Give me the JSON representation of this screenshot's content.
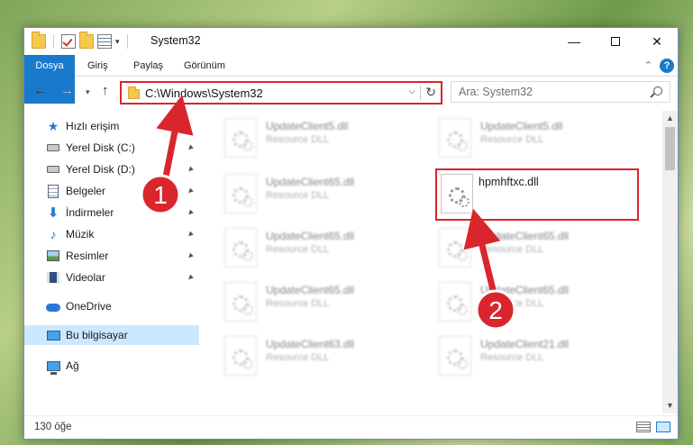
{
  "window": {
    "title": "System32",
    "minimize": "—",
    "maximize": "",
    "close": "✕"
  },
  "ribbon": {
    "tabs": [
      "Dosya",
      "Giriş",
      "Paylaş",
      "Görünüm"
    ],
    "collapse": "⌃",
    "help": "?"
  },
  "nav": {
    "back": "←",
    "forward": "→",
    "recent": "▾",
    "up": "↑",
    "address": "C:\\Windows\\System32",
    "address_dropdown": "⌵",
    "refresh": "↻",
    "search_placeholder": "Ara: System32"
  },
  "sidebar": {
    "items": [
      {
        "label": "Hızlı erişim",
        "icon": "star-icon",
        "pinned": false
      },
      {
        "label": "Yerel Disk (C:)",
        "icon": "disk-icon",
        "pinned": true
      },
      {
        "label": "Yerel Disk (D:)",
        "icon": "disk-icon",
        "pinned": true
      },
      {
        "label": "Belgeler",
        "icon": "documents-icon",
        "pinned": true
      },
      {
        "label": "İndirmeler",
        "icon": "download-icon",
        "pinned": true
      },
      {
        "label": "Müzik",
        "icon": "music-icon",
        "pinned": true
      },
      {
        "label": "Resimler",
        "icon": "pictures-icon",
        "pinned": true
      },
      {
        "label": "Videolar",
        "icon": "videos-icon",
        "pinned": true
      },
      {
        "label": "OneDrive",
        "icon": "onedrive-icon",
        "pinned": false
      },
      {
        "label": "Bu bilgisayar",
        "icon": "this-pc-icon",
        "pinned": false,
        "selected": true
      },
      {
        "label": "Ağ",
        "icon": "network-icon",
        "pinned": false
      }
    ],
    "pin_glyph": "📌"
  },
  "files": [
    {
      "name": "UpdateClient5.dll",
      "type": "Resource DLL"
    },
    {
      "name": "UpdateClient5.dll",
      "type": "Resource DLL"
    },
    {
      "name": "UpdateClient65.dll",
      "type": "Resource DLL"
    },
    {
      "name": "hpmhftxc.dll",
      "type": "",
      "selected": true
    },
    {
      "name": "UpdateClient65.dll",
      "type": "Resource DLL"
    },
    {
      "name": "UpdateClient65.dll",
      "type": "Resource DLL"
    },
    {
      "name": "UpdateClient65.dll",
      "type": "Resource DLL"
    },
    {
      "name": "UpdateClient65.dll",
      "type": "Resource DLL"
    },
    {
      "name": "UpdateClient63.dll",
      "type": "Resource DLL"
    },
    {
      "name": "UpdateClient21.dll",
      "type": "Resource DLL"
    }
  ],
  "status": {
    "item_count": "130 öğe"
  },
  "annotations": {
    "badge1": "1",
    "badge2": "2",
    "highlight_color": "#d9262c"
  },
  "colors": {
    "accent": "#1979ca",
    "selection": "#cce8ff",
    "annotation_red": "#d9262c"
  }
}
